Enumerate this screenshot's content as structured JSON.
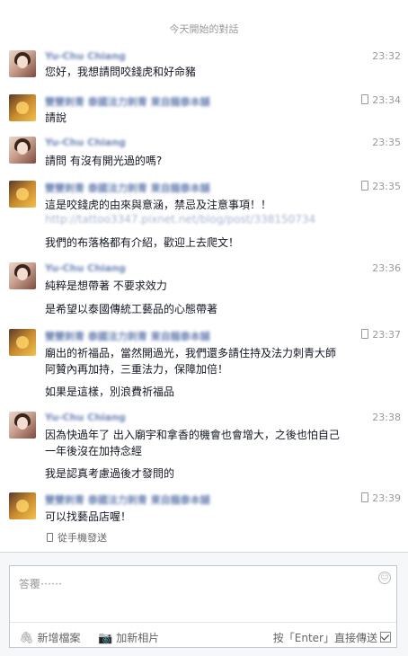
{
  "thread": {
    "day_header": "今天開始的對話",
    "messages": [
      {
        "sender": "Yu-Chu Chiang",
        "time": "23:32",
        "mobile": false,
        "avatar": "a",
        "lines": [
          {
            "text": "您好，我想請問咬錢虎和好命豬"
          }
        ]
      },
      {
        "sender": "雙雙刺青 泰國法力刺青 東自龍泰本舖",
        "time": "23:34",
        "mobile": true,
        "avatar": "b",
        "lines": [
          {
            "text": "請說"
          }
        ]
      },
      {
        "sender": "Yu-Chu Chiang",
        "time": "23:35",
        "mobile": false,
        "avatar": "a",
        "lines": [
          {
            "text": "請問 有沒有開光過的嗎?"
          }
        ]
      },
      {
        "sender": "雙雙刺青 泰國法力刺青 東自龍泰本舖",
        "time": "23:35",
        "mobile": true,
        "avatar": "b",
        "lines": [
          {
            "text": "這是咬錢虎的由來與意涵，禁忌及注意事項！！"
          },
          {
            "text": "http://tattoo3347.pixnet.net/blog/post/338150734",
            "blur": true
          },
          {
            "text": "我們的布落格都有介紹，歡迎上去爬文！"
          }
        ]
      },
      {
        "sender": "Yu-Chu Chiang",
        "time": "23:36",
        "mobile": false,
        "avatar": "a",
        "lines": [
          {
            "text": "純粹是想帶著 不要求效力"
          },
          {
            "text": "是希望以泰國傳統工藝品的心態帶著"
          }
        ]
      },
      {
        "sender": "雙雙刺青 泰國法力刺青 東自龍泰本舖",
        "time": "23:37",
        "mobile": true,
        "avatar": "b",
        "lines": [
          {
            "text": "廟出的祈福品，當然開過光，我們還多請住持及法力刺青大師"
          },
          {
            "text": "阿贊內再加持，三重法力，保障加倍！"
          },
          {
            "text": "如果是這樣，別浪費祈福品"
          }
        ]
      },
      {
        "sender": "Yu-Chu Chiang",
        "time": "23:38",
        "mobile": false,
        "avatar": "a",
        "lines": [
          {
            "text": "因為快過年了 出入廟宇和拿香的機會也會增大，之後也怕自己"
          },
          {
            "text": "一年後沒在加持念經"
          },
          {
            "text": "我是認真考慮過後才發問的"
          }
        ]
      },
      {
        "sender": "雙雙刺青 泰國法力刺青 東自龍泰本舖",
        "time": "23:39",
        "mobile": true,
        "avatar": "b",
        "lines": [
          {
            "text": "可以找藝品店喔！"
          }
        ]
      }
    ],
    "sent_via": "從手機發送"
  },
  "composer": {
    "placeholder": "答覆⋯⋯",
    "add_file_label": "新增檔案",
    "add_photo_label": "加新相片",
    "enter_send_label": "按「Enter」直接傳送",
    "enter_send_checked": true,
    "icons": {
      "emoji": "emoji-icon",
      "file": "paperclip-icon",
      "photo": "camera-icon",
      "phone": "phone-icon"
    }
  }
}
